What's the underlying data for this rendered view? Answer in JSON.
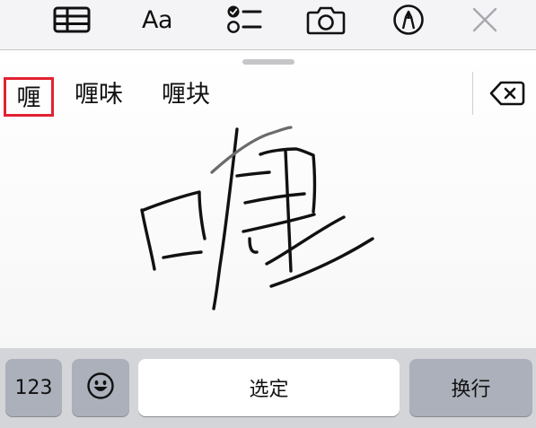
{
  "toolbar": {
    "table_icon": "table-icon",
    "text_format_label": "Aa",
    "checklist_icon": "checklist-icon",
    "camera_icon": "camera-icon",
    "markup_icon": "pen-markup-icon",
    "close_icon": "close-icon"
  },
  "handwriting": {
    "candidates": [
      "喱",
      "喱味",
      "喱块"
    ],
    "selected_index": 0,
    "highlight_color": "#e22232",
    "backspace_icon": "backspace-icon"
  },
  "keyboard": {
    "numbers_label": "123",
    "emoji_icon": "emoji-icon",
    "select_label": "选定",
    "return_label": "换行"
  }
}
